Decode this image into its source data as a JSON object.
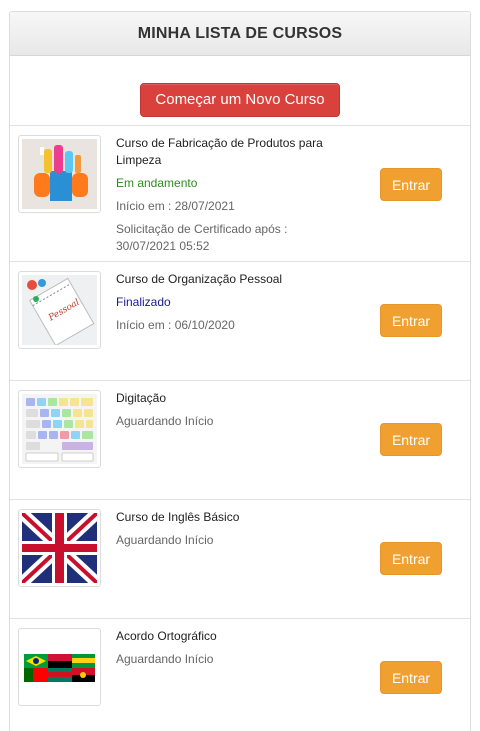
{
  "header": {
    "title": "MINHA LISTA DE CURSOS"
  },
  "actions": {
    "start_label": "Começar um Novo Curso"
  },
  "colors": {
    "in_progress": "#2e8b1f",
    "finished": "#1a1a8c",
    "enter": "#f0a030",
    "start": "#d9413d"
  },
  "courses": [
    {
      "title": "Curso de Fabricação de Produtos para Limpeza",
      "status": "Em andamento",
      "start": "Início em : 28/07/2021",
      "certificate": "Solicitação de Certificado após : 30/07/2021 05:52",
      "button": "Entrar",
      "thumb_icon": "cleaning-products-icon"
    },
    {
      "title": "Curso de Organização Pessoal",
      "status": "Finalizado",
      "start": "Início em : 06/10/2020",
      "button": "Entrar",
      "thumb_icon": "organizer-notebook-icon"
    },
    {
      "title": "Digitação",
      "status": "Aguardando Início",
      "button": "Entrar",
      "thumb_icon": "keyboard-icon"
    },
    {
      "title": "Curso de Inglês Básico",
      "status": "Aguardando Início",
      "button": "Entrar",
      "thumb_icon": "uk-flag-icon"
    },
    {
      "title": "Acordo Ortográfico",
      "status": "Aguardando Início",
      "button": "Entrar",
      "thumb_icon": "flags-puzzle-icon"
    }
  ]
}
